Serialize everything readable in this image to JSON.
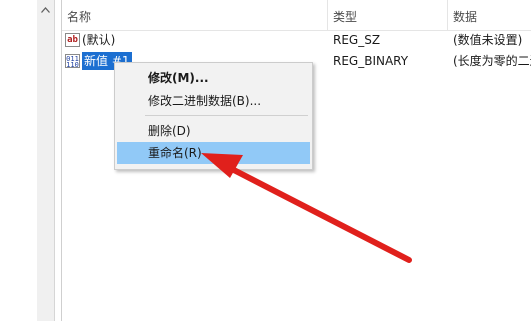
{
  "columns": {
    "name": "名称",
    "type": "类型",
    "data": "数据"
  },
  "rows": [
    {
      "icon": "string-value-icon",
      "icon_text": "ab",
      "name": "(默认)",
      "type": "REG_SZ",
      "data": "(数值未设置)"
    },
    {
      "icon": "binary-value-icon",
      "icon_text": "011",
      "name": "新值 #1",
      "type": "REG_BINARY",
      "data": "(长度为零的二进制值)"
    }
  ],
  "context_menu": {
    "items": [
      {
        "label": "修改(M)...",
        "bold": true
      },
      {
        "label": "修改二进制数据(B)...",
        "bold": false
      },
      {
        "label": "删除(D)",
        "bold": false
      },
      {
        "label": "重命名(R)",
        "bold": false,
        "highlighted": true
      }
    ]
  },
  "annotation": {
    "arrow_color": "#e0201c"
  },
  "colors": {
    "selection": "#1c6fd1",
    "menu_highlight": "#91c9f7",
    "menu_background": "#f2f2f2"
  }
}
